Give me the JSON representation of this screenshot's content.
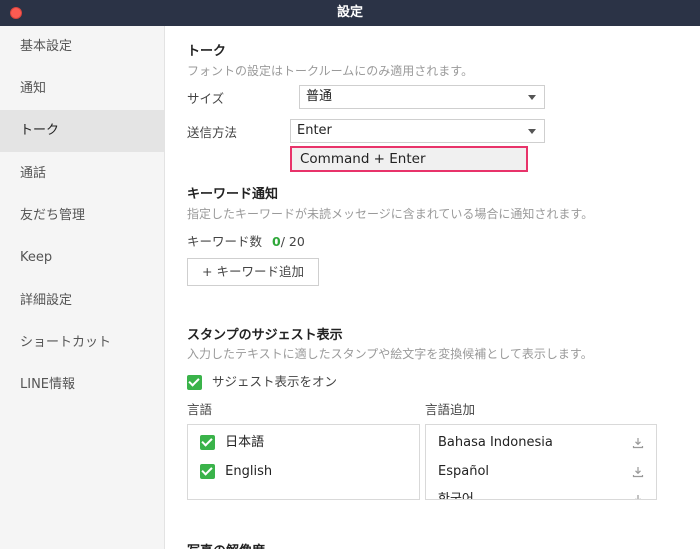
{
  "window": {
    "title": "設定"
  },
  "sidebar": {
    "items": [
      {
        "label": "基本設定"
      },
      {
        "label": "通知"
      },
      {
        "label": "トーク"
      },
      {
        "label": "通話"
      },
      {
        "label": "友だち管理"
      },
      {
        "label": "Keep"
      },
      {
        "label": "詳細設定"
      },
      {
        "label": "ショートカット"
      },
      {
        "label": "LINE情報"
      }
    ],
    "active": "トーク"
  },
  "talk": {
    "title": "トーク",
    "desc": "フォントの設定はトークルームにのみ適用されます。",
    "size_label": "サイズ",
    "size_value": "普通",
    "send_label": "送信方法",
    "send_value": "Enter",
    "dropdown_option": "Command + Enter"
  },
  "keyword": {
    "title": "キーワード通知",
    "desc": "指定したキーワードが未読メッセージに含まれている場合に通知されます。",
    "count_label": "キーワード数",
    "count_current": "0",
    "count_max": "/ 20",
    "add_button": "+ キーワード追加"
  },
  "sticker": {
    "title": "スタンプのサジェスト表示",
    "desc": "入力したテキストに適したスタンプや絵文字を変換候補として表示します。",
    "toggle_label": "サジェスト表示をオン",
    "languages_header": "言語",
    "add_languages_header": "言語追加",
    "languages": [
      {
        "label": "日本語"
      },
      {
        "label": "English"
      }
    ],
    "add_languages": [
      {
        "label": "Bahasa Indonesia"
      },
      {
        "label": "Español"
      },
      {
        "label": "한국어"
      }
    ]
  },
  "photo": {
    "title": "写真の解像度"
  },
  "colors": {
    "titlebar": "#2b3346",
    "accent_green": "#3ab34a",
    "highlight": "#e8336a"
  }
}
